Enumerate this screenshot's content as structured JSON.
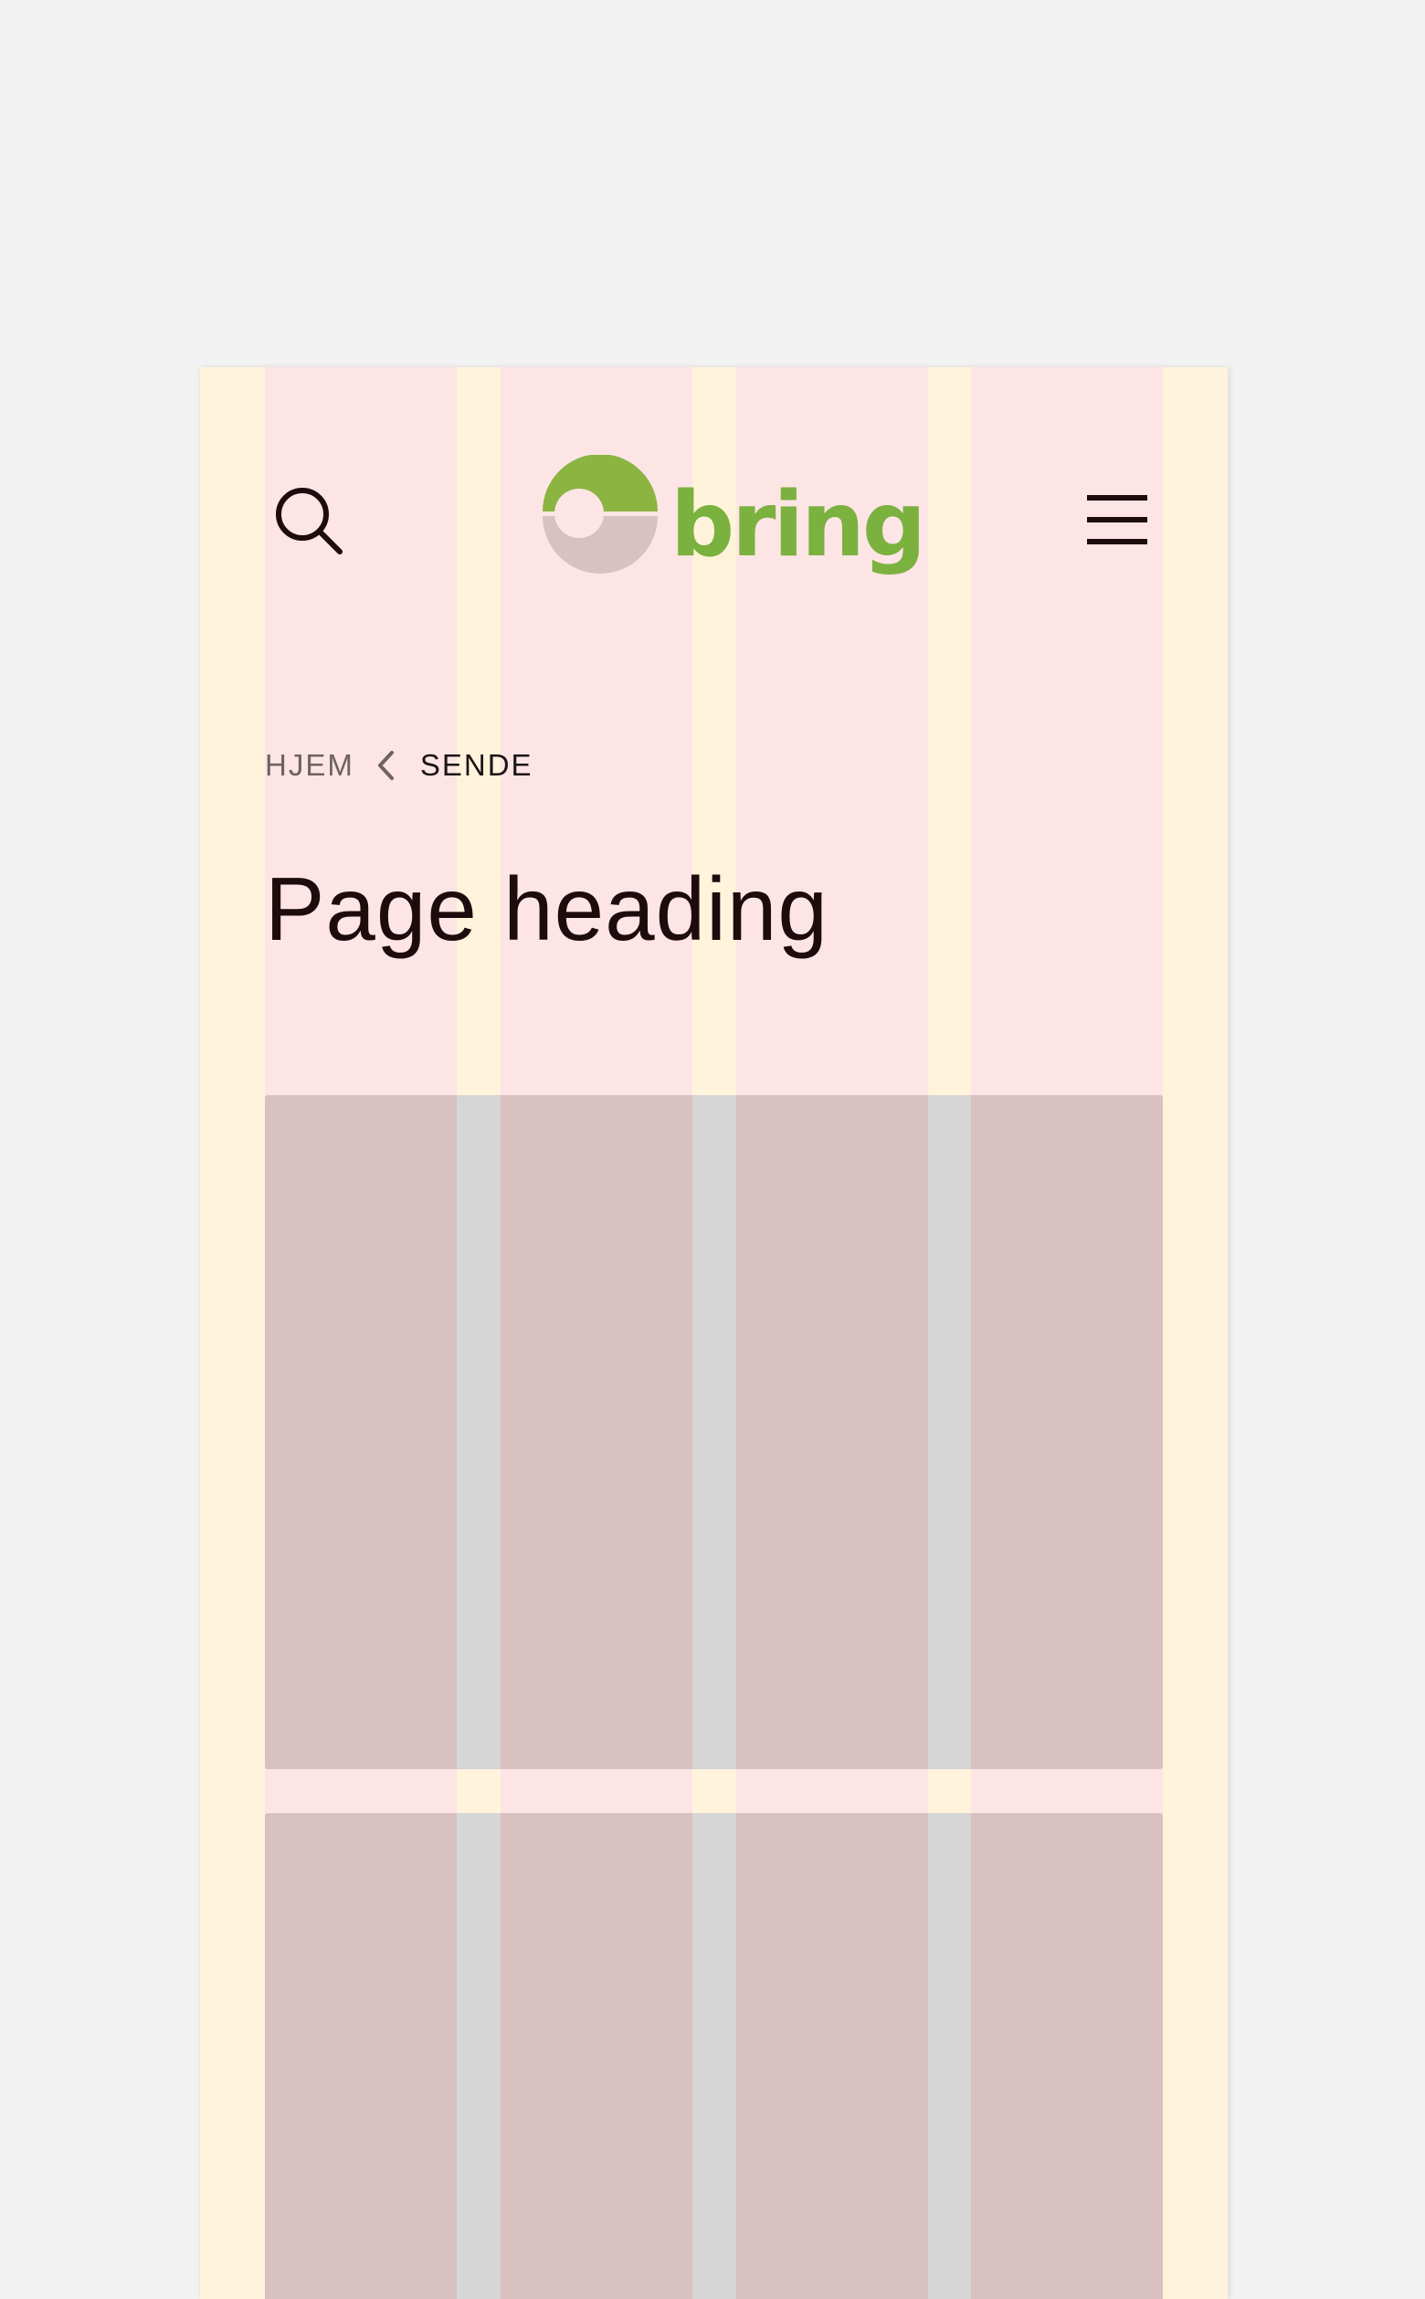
{
  "header": {
    "search_icon": "search-icon",
    "menu_icon": "hamburger-menu-icon",
    "logo_text": "bring",
    "logo_color": "#7bb13f"
  },
  "breadcrumb": {
    "home": "HJEM",
    "separator_icon": "chevron-left-icon",
    "current": "SENDE"
  },
  "page": {
    "heading": "Page heading"
  },
  "colors": {
    "background": "#f2f2f2",
    "outer_margin": "#fff3db",
    "grid_column": "#fde5e5",
    "gutter": "#ffffff",
    "content_block": "#d9c1c1",
    "content_gutter": "#d6d6d6",
    "text_dark": "#1d0b0e"
  }
}
